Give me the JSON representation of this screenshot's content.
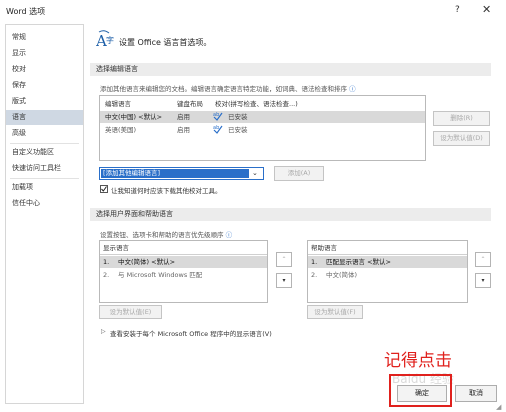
{
  "window": {
    "title": "Word 选项",
    "help": "?",
    "close": "✕"
  },
  "nav": {
    "items": [
      {
        "label": "常规"
      },
      {
        "label": "显示"
      },
      {
        "label": "校对"
      },
      {
        "label": "保存"
      },
      {
        "label": "版式"
      },
      {
        "label": "语言"
      },
      {
        "label": "高级"
      },
      {
        "label": "自定义功能区"
      },
      {
        "label": "快速访问工具栏"
      },
      {
        "label": "加载项"
      },
      {
        "label": "信任中心"
      }
    ],
    "selected": "语言"
  },
  "header": {
    "title": "设置 Office 语言首选项。",
    "icon": "language-settings-icon"
  },
  "editing": {
    "section_title": "选择编辑语言",
    "description": "添加其他语言来编辑您的文档。编辑语言确定语言特定功能，如词典、语法检查和排序",
    "columns": [
      "编辑语言",
      "键盘布局",
      "校对(拼写检查、语法检查...)"
    ],
    "rows": [
      {
        "language": "中文(中国) <默认>",
        "keyboard": "启用",
        "proofing": "已安装"
      },
      {
        "language": "英语(美国)",
        "keyboard": "启用",
        "proofing": "已安装"
      }
    ],
    "remove_button": "删除(R)",
    "set_default_button": "设为默认值(D)",
    "add_dropdown_value": "[添加其他编辑语言]",
    "add_button": "添加(A)",
    "checkbox_label": "让我知道何时应该下载其他校对工具。",
    "checkbox_checked": true
  },
  "display": {
    "section_title": "选择用户界面和帮助语言",
    "description": "设置按钮、选项卡和帮助的语言优先级顺序",
    "display_list": {
      "header": "显示语言",
      "items": [
        {
          "num": "1.",
          "label": "中文(简体) <默认>"
        },
        {
          "num": "2.",
          "label": "与 Microsoft Windows 匹配"
        }
      ],
      "set_default_button": "设为默认值(E)"
    },
    "help_list": {
      "header": "帮助语言",
      "items": [
        {
          "num": "1.",
          "label": "匹配显示语言 <默认>"
        },
        {
          "num": "2.",
          "label": "中文(简体)"
        }
      ],
      "set_default_button": "设为默认值(F)"
    },
    "view_link": "查看安装于每个 Microsoft Office 程序中的显示语言(V)"
  },
  "footer": {
    "ok_button": "确定",
    "cancel_button": "取消"
  },
  "annotation": {
    "text": "记得点击",
    "watermark": "Baidu 经验",
    "color": "#e0211d"
  }
}
